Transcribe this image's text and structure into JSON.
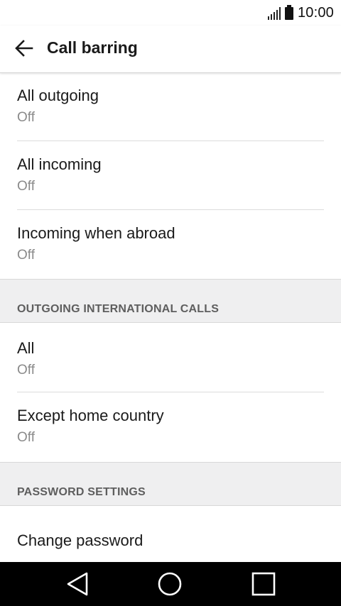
{
  "status_bar": {
    "time": "10:00"
  },
  "app_bar": {
    "title": "Call barring",
    "back_icon": "arrow-left-icon"
  },
  "items_group1": [
    {
      "title": "All outgoing",
      "summary": "Off"
    },
    {
      "title": "All incoming",
      "summary": "Off"
    },
    {
      "title": "Incoming when abroad",
      "summary": "Off"
    }
  ],
  "section_international": {
    "label": "OUTGOING INTERNATIONAL CALLS",
    "items": [
      {
        "title": "All",
        "summary": "Off"
      },
      {
        "title": "Except home country",
        "summary": "Off"
      }
    ]
  },
  "section_password": {
    "label": "PASSWORD SETTINGS",
    "items": [
      {
        "title": "Change password"
      }
    ]
  },
  "nav_bar": {
    "back_icon": "triangle-back-icon",
    "home_icon": "circle-home-icon",
    "recents_icon": "square-recents-icon"
  }
}
